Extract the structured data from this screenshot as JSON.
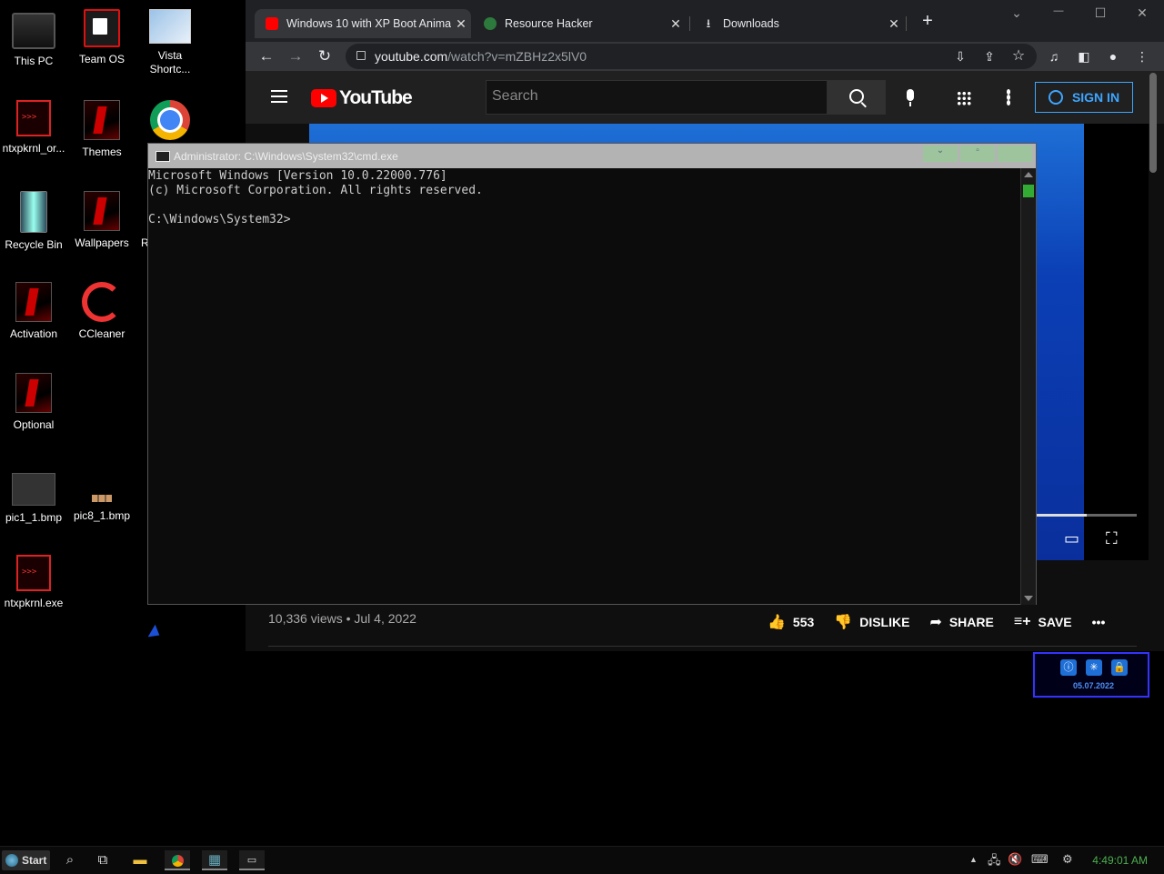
{
  "desktop": {
    "icons": [
      {
        "label": "This PC"
      },
      {
        "label": "Team OS"
      },
      {
        "label": "Vista Shortc..."
      },
      {
        "label": "ntxpkrnl_or..."
      },
      {
        "label": "Themes"
      },
      {
        "label": "Recycle Bin"
      },
      {
        "label": "Wallpapers"
      },
      {
        "label": "R"
      },
      {
        "label": "Activation"
      },
      {
        "label": "CCleaner"
      },
      {
        "label": "Optional"
      },
      {
        "label": "pic1_1.bmp"
      },
      {
        "label": "pic8_1.bmp"
      },
      {
        "label": "ntxpkrnl.exe"
      }
    ]
  },
  "browser": {
    "tabs": [
      {
        "title": "Windows 10 with XP Boot Anima",
        "close": "✕"
      },
      {
        "title": "Resource Hacker",
        "close": "✕"
      },
      {
        "title": "Downloads",
        "close": "✕"
      }
    ],
    "new_tab": "+",
    "url_host": "youtube.com",
    "url_path": "/watch?v=mZBHz2x5lV0",
    "window_controls": {
      "list": "⌄",
      "minimize": "—",
      "maximize": "☐",
      "close": "✕"
    }
  },
  "youtube": {
    "logo": "YouTube",
    "search_placeholder": "Search",
    "sign_in": "SIGN IN",
    "views_date": "10,336 views • Jul 4, 2022",
    "likes": "553",
    "dislike": "DISLIKE",
    "share": "SHARE",
    "save": "SAVE",
    "more": "•••",
    "progress_fraction": 0.5
  },
  "cmd": {
    "title": "Administrator: C:\\Windows\\System32\\cmd.exe",
    "lines": [
      "Microsoft Windows [Version 10.0.22000.776]",
      "(c) Microsoft Corporation. All rights reserved.",
      "",
      "C:\\Windows\\System32>"
    ]
  },
  "widget": {
    "date": "05.07.2022"
  },
  "taskbar": {
    "start": "Start",
    "clock": "4:49:01 AM"
  },
  "colors": {
    "youtube_red": "#ff0000",
    "signin_blue": "#3ea6ff",
    "clock_green": "#4caf50"
  }
}
